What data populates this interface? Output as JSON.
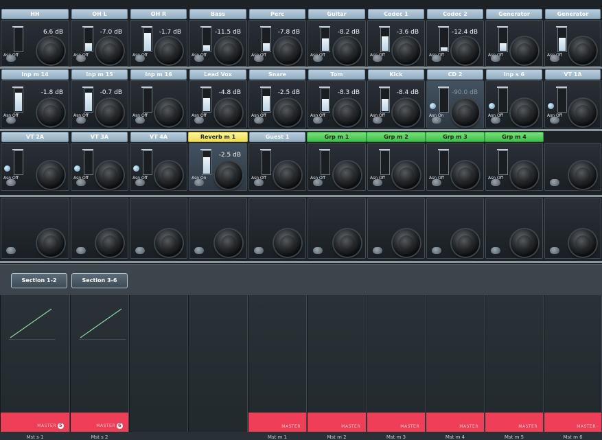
{
  "colors": {
    "label_strip": "#a9bfce",
    "group_strip": "#46c353",
    "fx_strip": "#f3e46a",
    "master_bar": "#ef3e57"
  },
  "rows": [
    {
      "cells": [
        {
          "label": "HH",
          "value": "6.6 dB",
          "assign": "Asn Off",
          "meter": 0.0
        },
        {
          "label": "OH L",
          "value": "-7.0 dB",
          "assign": "Asn Off",
          "meter": 0.35
        },
        {
          "label": "OH R",
          "value": "-1.7 dB",
          "assign": "Asn Off",
          "meter": 0.8
        },
        {
          "label": "Bass",
          "value": "-11.5 dB",
          "assign": "Asn Off",
          "meter": 0.25
        },
        {
          "label": "Perc",
          "value": "-7.8 dB",
          "assign": "Asn Off",
          "meter": 0.35
        },
        {
          "label": "Guitar",
          "value": "-8.2 dB",
          "assign": "Asn Off",
          "meter": 0.55
        },
        {
          "label": "Codec 1",
          "value": "-3.6 dB",
          "assign": "Asn Off",
          "meter": 0.65
        },
        {
          "label": "Codec 2",
          "value": "-12.4 dB",
          "assign": "Asn Off",
          "meter": 0.15
        },
        {
          "label": "Generator",
          "value": "",
          "assign": "Asn Off",
          "meter": 0.35
        },
        {
          "label": "Generator",
          "value": "",
          "assign": "Asn Off",
          "meter": 0.6
        }
      ]
    },
    {
      "cells": [
        {
          "label": "Inp m 14",
          "value": "-1.8 dB",
          "assign": "Asn Off",
          "meter": 0.85
        },
        {
          "label": "Inp m 15",
          "value": "-0.7 dB",
          "assign": "Asn Off",
          "meter": 0.85
        },
        {
          "label": "Inp m 16",
          "value": "",
          "assign": "Asn Off",
          "meter": 0.0
        },
        {
          "label": "Lead Vox",
          "value": "-4.8 dB",
          "assign": "Asn Off",
          "meter": 0.6
        },
        {
          "label": "Snare",
          "value": "-2.5 dB",
          "assign": "Asn Off",
          "meter": 0.7
        },
        {
          "label": "Tom",
          "value": "-8.3 dB",
          "assign": "Asn Off",
          "meter": 0.55
        },
        {
          "label": "Kick",
          "value": "-8.4 dB",
          "assign": "Asn Off",
          "meter": 0.55
        },
        {
          "label": "CD 2",
          "value": "-90.0 dB",
          "assign": "Asn On",
          "meter": 0.0,
          "dim": true,
          "hl": true,
          "led": true
        },
        {
          "label": "Inp s 6",
          "value": "",
          "assign": "Asn Off",
          "meter": 0.0,
          "led": true
        },
        {
          "label": "VT 1A",
          "value": "",
          "assign": "Asn Off",
          "meter": 0.0,
          "led": true
        }
      ]
    },
    {
      "cells": [
        {
          "label": "VT 2A",
          "value": "",
          "assign": "Asn Off",
          "meter": 0.0,
          "led": true
        },
        {
          "label": "VT 3A",
          "value": "",
          "assign": "Asn Off",
          "meter": 0.0,
          "led": true
        },
        {
          "label": "VT 4A",
          "value": "",
          "assign": "Asn Off",
          "meter": 0.0,
          "led": true
        },
        {
          "label": "Reverb m 1",
          "value": "-2.5 dB",
          "assign": "Asn On",
          "meter": 0.75,
          "strip": "yellow",
          "hl": true
        },
        {
          "label": "Guest 1",
          "value": "",
          "assign": "Asn Off",
          "meter": 0.0
        },
        {
          "label": "Grp m 1",
          "value": "",
          "assign": "Asn Off",
          "meter": 0.0,
          "strip": "green"
        },
        {
          "label": "Grp m 2",
          "value": "",
          "assign": "Asn Off",
          "meter": 0.0,
          "strip": "green"
        },
        {
          "label": "Grp m 3",
          "value": "",
          "assign": "Asn Off",
          "meter": 0.0,
          "strip": "green"
        },
        {
          "label": "Grp m 4",
          "value": "",
          "assign": "Asn Off",
          "meter": 0.0,
          "strip": "green"
        },
        {
          "label": "",
          "value": "",
          "assign": "",
          "meter": 0.0,
          "empty": true
        }
      ]
    }
  ],
  "sections": [
    {
      "label": "Section 1-2"
    },
    {
      "label": "Section 3-6"
    }
  ],
  "masters": [
    {
      "name": "Mst s 1",
      "sub": "Mst s 1",
      "tag": "MASTER",
      "num": "5",
      "graph": true
    },
    {
      "name": "Mst s 2",
      "sub": "Mst s 2",
      "tag": "MASTER",
      "num": "6",
      "graph": true
    },
    {
      "name": "",
      "sub": "",
      "tag": "",
      "num": "",
      "blank": true
    },
    {
      "name": "",
      "sub": "",
      "tag": "",
      "num": "",
      "blank": true
    },
    {
      "name": "Mst m 1",
      "sub": "Mst m 1",
      "tag": "MASTER",
      "num": ""
    },
    {
      "name": "Mst m 2",
      "sub": "Mst m 2",
      "tag": "MASTER",
      "num": ""
    },
    {
      "name": "Mst m 3",
      "sub": "Mst m 3",
      "tag": "MASTER",
      "num": ""
    },
    {
      "name": "Mst m 4",
      "sub": "Mst m 4",
      "tag": "MASTER",
      "num": ""
    },
    {
      "name": "Mst m 5",
      "sub": "Mst m 5",
      "tag": "MASTER",
      "num": ""
    },
    {
      "name": "Mst m 6",
      "sub": "Mst m 6",
      "tag": "MASTER",
      "num": ""
    }
  ]
}
